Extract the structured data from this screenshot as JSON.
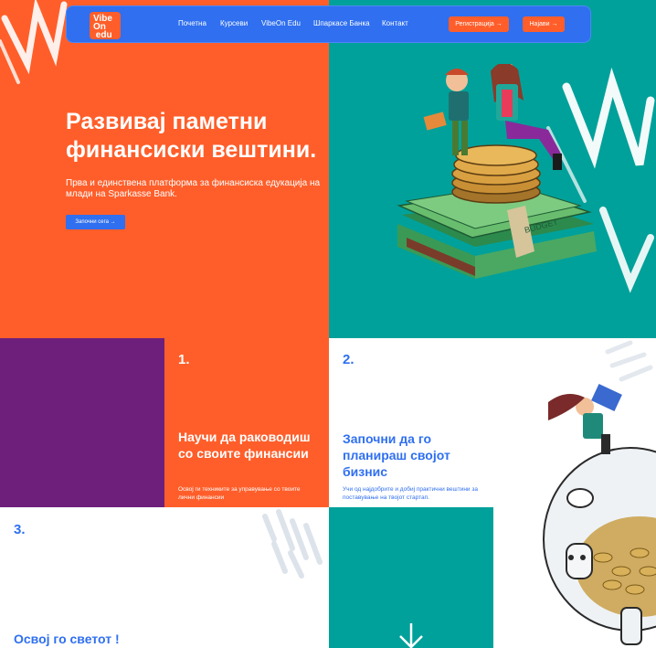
{
  "nav": {
    "logo_text": "VibeOn edu",
    "links": [
      "Почетна",
      "Курсеви",
      "VibeOn Edu",
      "Шпаркасе Банка",
      "Контакт"
    ],
    "register_label": "Регистрација →",
    "login_label": "Најави →"
  },
  "hero": {
    "title": "Развивај паметни финансиски вештини.",
    "subtitle": "Прва и единствена платформа за финансиска едукација на млади на Sparkasse Bank.",
    "cta_label": "Започни сега →",
    "illustration_text": "BUDGET"
  },
  "steps": [
    {
      "number": "1.",
      "title": "Научи да раководиш со своите финансии",
      "desc": "Освој ги техниките за управување со твоите лични финансии"
    },
    {
      "number": "2.",
      "title": "Започни да го планираш својот бизнис",
      "desc": "Учи од најдобрите и добиј практични вештини за поставување на твојот стартап."
    },
    {
      "number": "3.",
      "title": "Освој го светот !"
    }
  ],
  "colors": {
    "orange": "#ff5e2a",
    "teal": "#00a19a",
    "purple": "#6e1f7c",
    "blue": "#2f6ff0"
  }
}
